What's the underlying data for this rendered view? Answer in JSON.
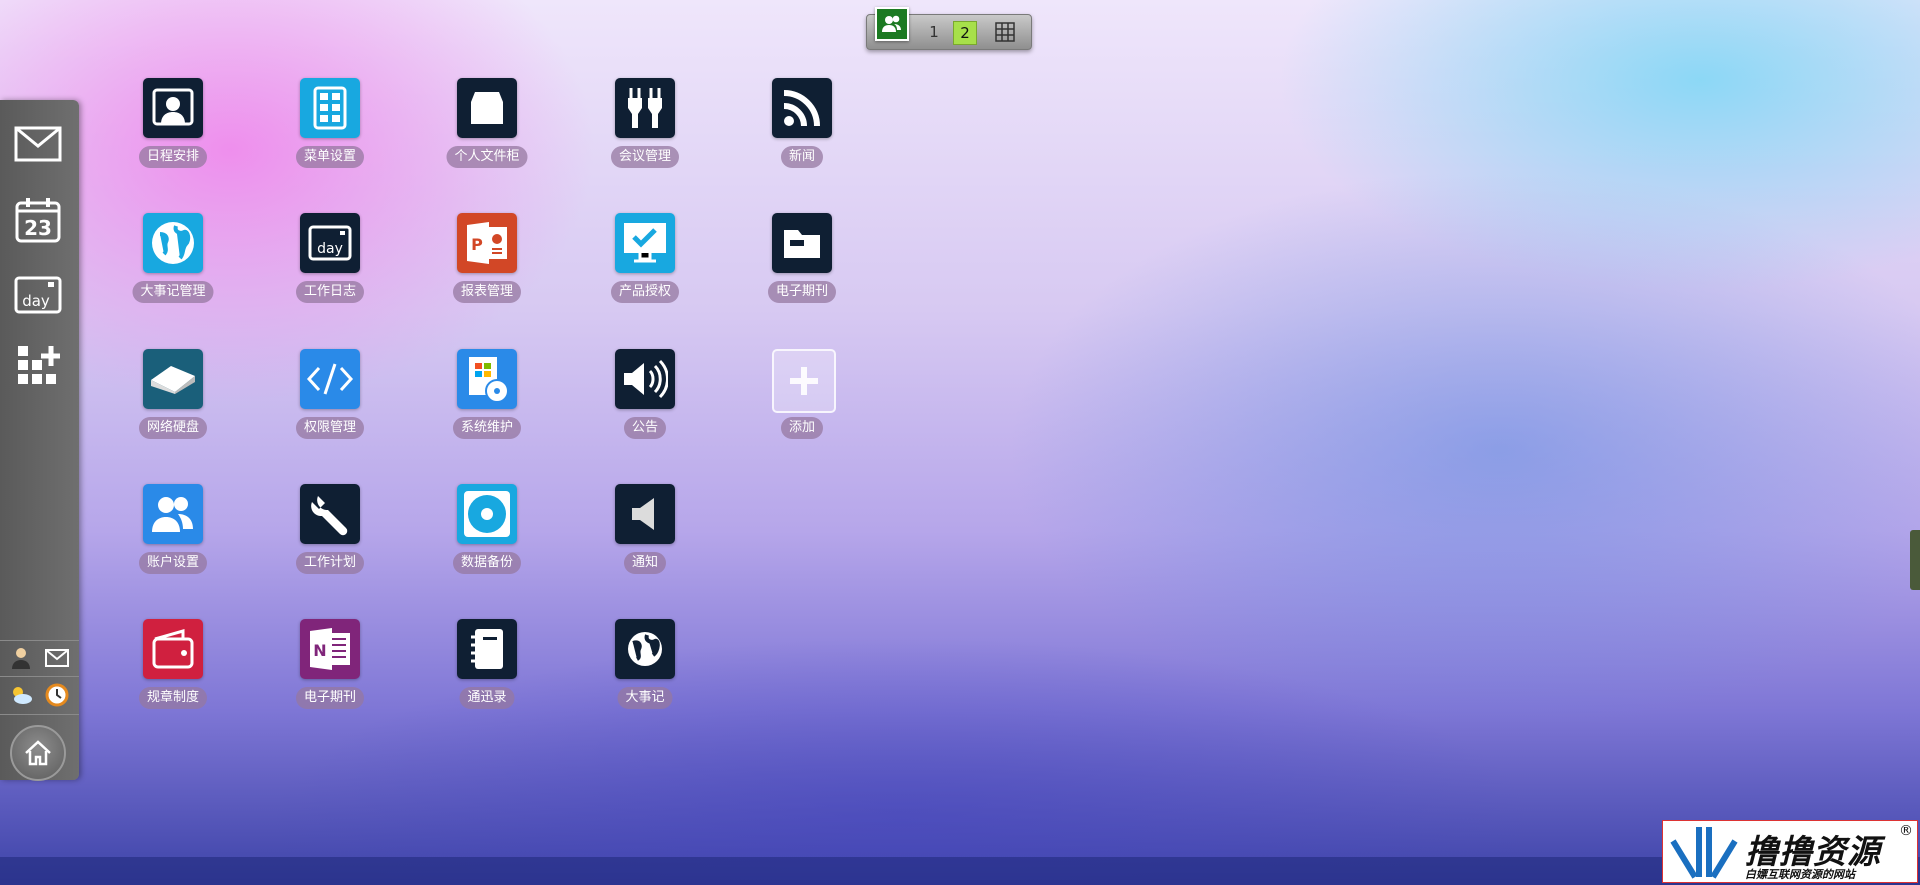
{
  "switcher": {
    "page1": "1",
    "page2": "2"
  },
  "apps": [
    {
      "label": "日程安排",
      "color": "#0f1f33",
      "icon": "schedule-icon"
    },
    {
      "label": "菜单设置",
      "color": "#18a8e0",
      "icon": "menu-grid-icon"
    },
    {
      "label": "个人文件柜",
      "color": "#0f1f33",
      "icon": "cabinet-icon"
    },
    {
      "label": "会议管理",
      "color": "#0f1f33",
      "icon": "plug-icon"
    },
    {
      "label": "新闻",
      "color": "#0f1f33",
      "icon": "rss-icon"
    },
    {
      "label": "大事记管理",
      "color": "#18a8e0",
      "icon": "globe-icon"
    },
    {
      "label": "工作日志",
      "color": "#0f1f33",
      "icon": "day-calendar-icon"
    },
    {
      "label": "报表管理",
      "color": "#d24726",
      "icon": "powerpoint-icon"
    },
    {
      "label": "产品授权",
      "color": "#18a8e0",
      "icon": "monitor-check-icon"
    },
    {
      "label": "电子期刊",
      "color": "#0f1f33",
      "icon": "folder-icon"
    },
    {
      "label": "网络硬盘",
      "color": "#1a5f7a",
      "icon": "hard-drive-icon"
    },
    {
      "label": "权限管理",
      "color": "#2a8ae8",
      "icon": "code-icon"
    },
    {
      "label": "系统维护",
      "color": "#2a8ae8",
      "icon": "install-disc-icon"
    },
    {
      "label": "公告",
      "color": "#0f1f33",
      "icon": "speaker-loud-icon"
    },
    {
      "label": "添加",
      "color": "#ffffff",
      "icon": "plus-icon"
    },
    {
      "label": "账户设置",
      "color": "#2a8ae8",
      "icon": "users-icon"
    },
    {
      "label": "工作计划",
      "color": "#0f1f33",
      "icon": "wrench-icon"
    },
    {
      "label": "数据备份",
      "color": "#18a8e0",
      "icon": "disc-icon"
    },
    {
      "label": "通知",
      "color": "#0f1f33",
      "icon": "speaker-icon"
    },
    {
      "label": "规章制度",
      "color": "#d0203f",
      "icon": "wallet-icon"
    },
    {
      "label": "电子期刊",
      "color": "#80257a",
      "icon": "onenote-icon"
    },
    {
      "label": "通迅录",
      "color": "#0f1f33",
      "icon": "notebook-icon"
    },
    {
      "label": "大事记",
      "color": "#0f1f33",
      "icon": "globe-dark-icon"
    }
  ],
  "dock": {
    "items": [
      "mail-icon",
      "calendar-icon",
      "day-icon",
      "widgets-add-icon"
    ],
    "calendar_day": "23",
    "day_text": "day"
  },
  "logo": {
    "brand": "撸撸资源",
    "slogan": "白嫖互联网资源的网站",
    "reg": "®"
  }
}
